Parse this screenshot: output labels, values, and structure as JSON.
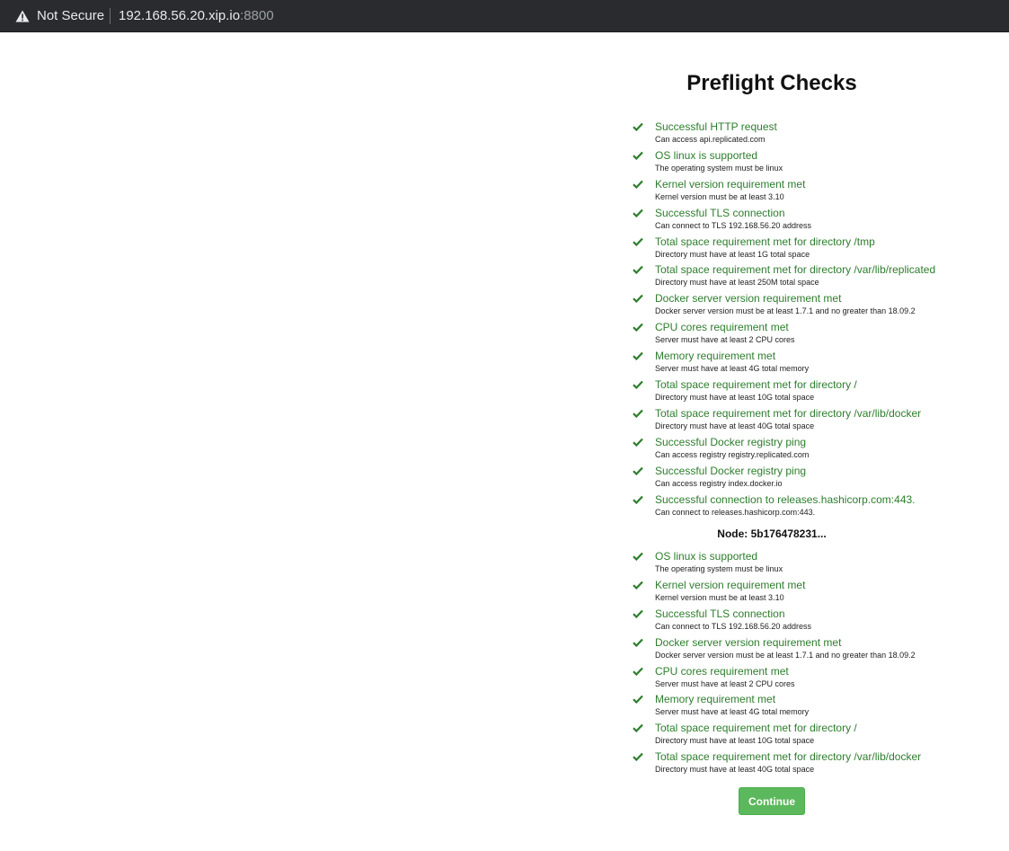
{
  "browser": {
    "security_label": "Not Secure",
    "url_host": "192.168.56.20.xip.io",
    "url_port": ":8800"
  },
  "page": {
    "title": "Preflight Checks",
    "node_label": "Node: 5b176478231...",
    "continue_label": "Continue",
    "status_color": "#2d7d2d",
    "button_color": "#5cb85c"
  },
  "checks": [
    {
      "title": "Successful HTTP request",
      "desc": "Can access api.replicated.com"
    },
    {
      "title": "OS linux is supported",
      "desc": "The operating system must be linux"
    },
    {
      "title": "Kernel version requirement met",
      "desc": "Kernel version must be at least 3.10"
    },
    {
      "title": "Successful TLS connection",
      "desc": "Can connect to TLS 192.168.56.20 address"
    },
    {
      "title": "Total space requirement met for directory /tmp",
      "desc": "Directory must have at least 1G total space"
    },
    {
      "title": "Total space requirement met for directory /var/lib/replicated",
      "desc": "Directory must have at least 250M total space"
    },
    {
      "title": "Docker server version requirement met",
      "desc": "Docker server version must be at least 1.7.1 and no greater than 18.09.2"
    },
    {
      "title": "CPU cores requirement met",
      "desc": "Server must have at least 2 CPU cores"
    },
    {
      "title": "Memory requirement met",
      "desc": "Server must have at least 4G total memory"
    },
    {
      "title": "Total space requirement met for directory /",
      "desc": "Directory must have at least 10G total space"
    },
    {
      "title": "Total space requirement met for directory /var/lib/docker",
      "desc": "Directory must have at least 40G total space"
    },
    {
      "title": "Successful Docker registry ping",
      "desc": "Can access registry registry.replicated.com"
    },
    {
      "title": "Successful Docker registry ping",
      "desc": "Can access registry index.docker.io"
    },
    {
      "title": "Successful connection to releases.hashicorp.com:443.",
      "desc": "Can connect to releases.hashicorp.com:443."
    }
  ],
  "node_checks": [
    {
      "title": "OS linux is supported",
      "desc": "The operating system must be linux"
    },
    {
      "title": "Kernel version requirement met",
      "desc": "Kernel version must be at least 3.10"
    },
    {
      "title": "Successful TLS connection",
      "desc": "Can connect to TLS 192.168.56.20 address"
    },
    {
      "title": "Docker server version requirement met",
      "desc": "Docker server version must be at least 1.7.1 and no greater than 18.09.2"
    },
    {
      "title": "CPU cores requirement met",
      "desc": "Server must have at least 2 CPU cores"
    },
    {
      "title": "Memory requirement met",
      "desc": "Server must have at least 4G total memory"
    },
    {
      "title": "Total space requirement met for directory /",
      "desc": "Directory must have at least 10G total space"
    },
    {
      "title": "Total space requirement met for directory /var/lib/docker",
      "desc": "Directory must have at least 40G total space"
    }
  ]
}
